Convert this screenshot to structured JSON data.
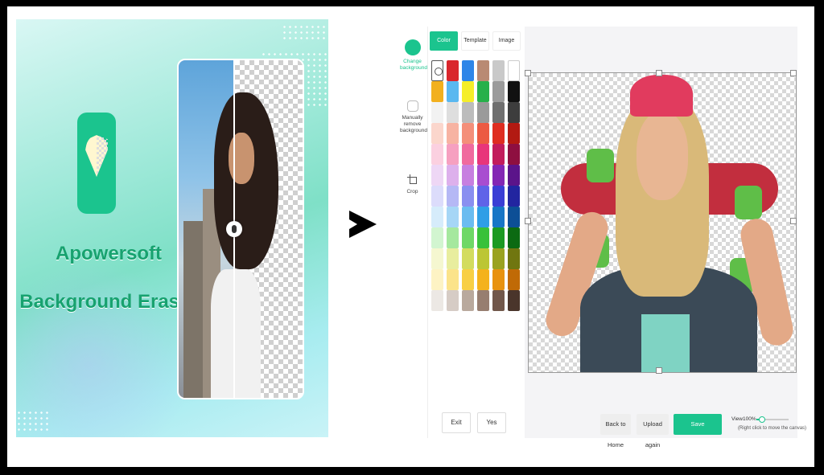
{
  "promo": {
    "title_line1": "Apowersoft",
    "title_line2": "Background Eraser"
  },
  "editor": {
    "tools": [
      {
        "label": "Change background",
        "icon": "change-background-icon",
        "active": true
      },
      {
        "label": "Manually remove background",
        "icon": "manual-remove-icon",
        "active": false
      },
      {
        "label": "Crop",
        "icon": "crop-icon",
        "active": false
      }
    ],
    "tabs": [
      {
        "label": "Color",
        "active": true
      },
      {
        "label": "Template",
        "active": false
      },
      {
        "label": "Image",
        "active": false
      }
    ],
    "swatch_colors": [
      "none",
      "#d9262c",
      "#2e86e8",
      "#b98a73",
      "#c9c9c9",
      "#ffffff",
      "#f2b01e",
      "#5ab8f0",
      "#f5ee2a",
      "#26b04a",
      "#9b9b9b",
      "#111111",
      "#f2f2f2",
      "#dedede",
      "#bcbcbc",
      "#9a9a9a",
      "#6f6f6f",
      "#3d3d3d",
      "#fbd6cc",
      "#f7b3a2",
      "#f48f7a",
      "#ec5a43",
      "#df2d20",
      "#b21a12",
      "#fbd0e0",
      "#f6a0c0",
      "#f06a9e",
      "#e8357a",
      "#c21c5c",
      "#8e0f40",
      "#eed7f5",
      "#ddb0ec",
      "#c77fe0",
      "#a84dd0",
      "#8326b4",
      "#5b148a",
      "#dcdcfb",
      "#b5b8f5",
      "#8a8ff0",
      "#5f63e8",
      "#3a3ed5",
      "#2225a0",
      "#d6ecfb",
      "#a6d6f6",
      "#6bbcf0",
      "#2f9ee6",
      "#1776c6",
      "#0d4f96",
      "#d2f5d0",
      "#a5e89e",
      "#6fd866",
      "#38c13a",
      "#1c9a22",
      "#0c6a12",
      "#f5f7d0",
      "#e8ed9e",
      "#d3dc5f",
      "#bcc634",
      "#9aa220",
      "#707610",
      "#fdf3c4",
      "#fbe38a",
      "#f8cf45",
      "#f4b21c",
      "#e8920f",
      "#c06a06",
      "#ece8e4",
      "#d6ccc5",
      "#b9a99d",
      "#977e70",
      "#71574a",
      "#4a352b"
    ],
    "exit_label": "Exit",
    "yes_label": "Yes",
    "back_home_label": "Back to Home",
    "upload_again_label": "Upload again",
    "save_label": "Save",
    "view_label": "View100%",
    "zoom_level": 0.15,
    "canvas_hint": "(Right click to move the canvas)"
  },
  "colors": {
    "accent": "#1bc48e",
    "promo_title": "#17a26f"
  }
}
